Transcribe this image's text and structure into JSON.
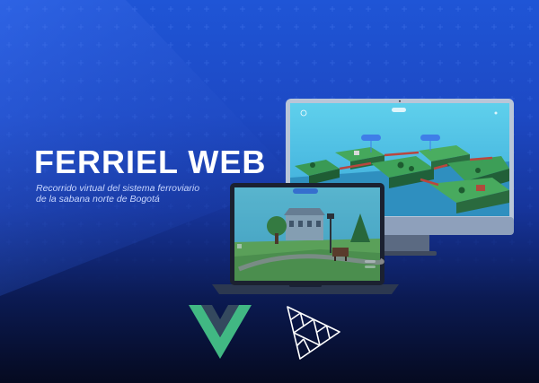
{
  "hero": {
    "title": "FERRIEL WEB",
    "subtitle_line1": "Recorrido virtual del sistema ferroviario",
    "subtitle_line2": "de la sabana norte de Bogotá"
  },
  "imac_screen": {
    "markers": [
      "Marker",
      "Marker"
    ]
  },
  "laptop_screen": {
    "tag": "Marker"
  },
  "logos": {
    "vue": "vue-logo",
    "threejs": "threejs-logo"
  },
  "colors": {
    "background_top": "#1f55d6",
    "background_bottom": "#050a20",
    "title": "#ffffff",
    "subtitle": "#c8d6ff",
    "vue_green": "#41b883",
    "vue_dark": "#34495e",
    "sky": "#5bc8e6"
  }
}
